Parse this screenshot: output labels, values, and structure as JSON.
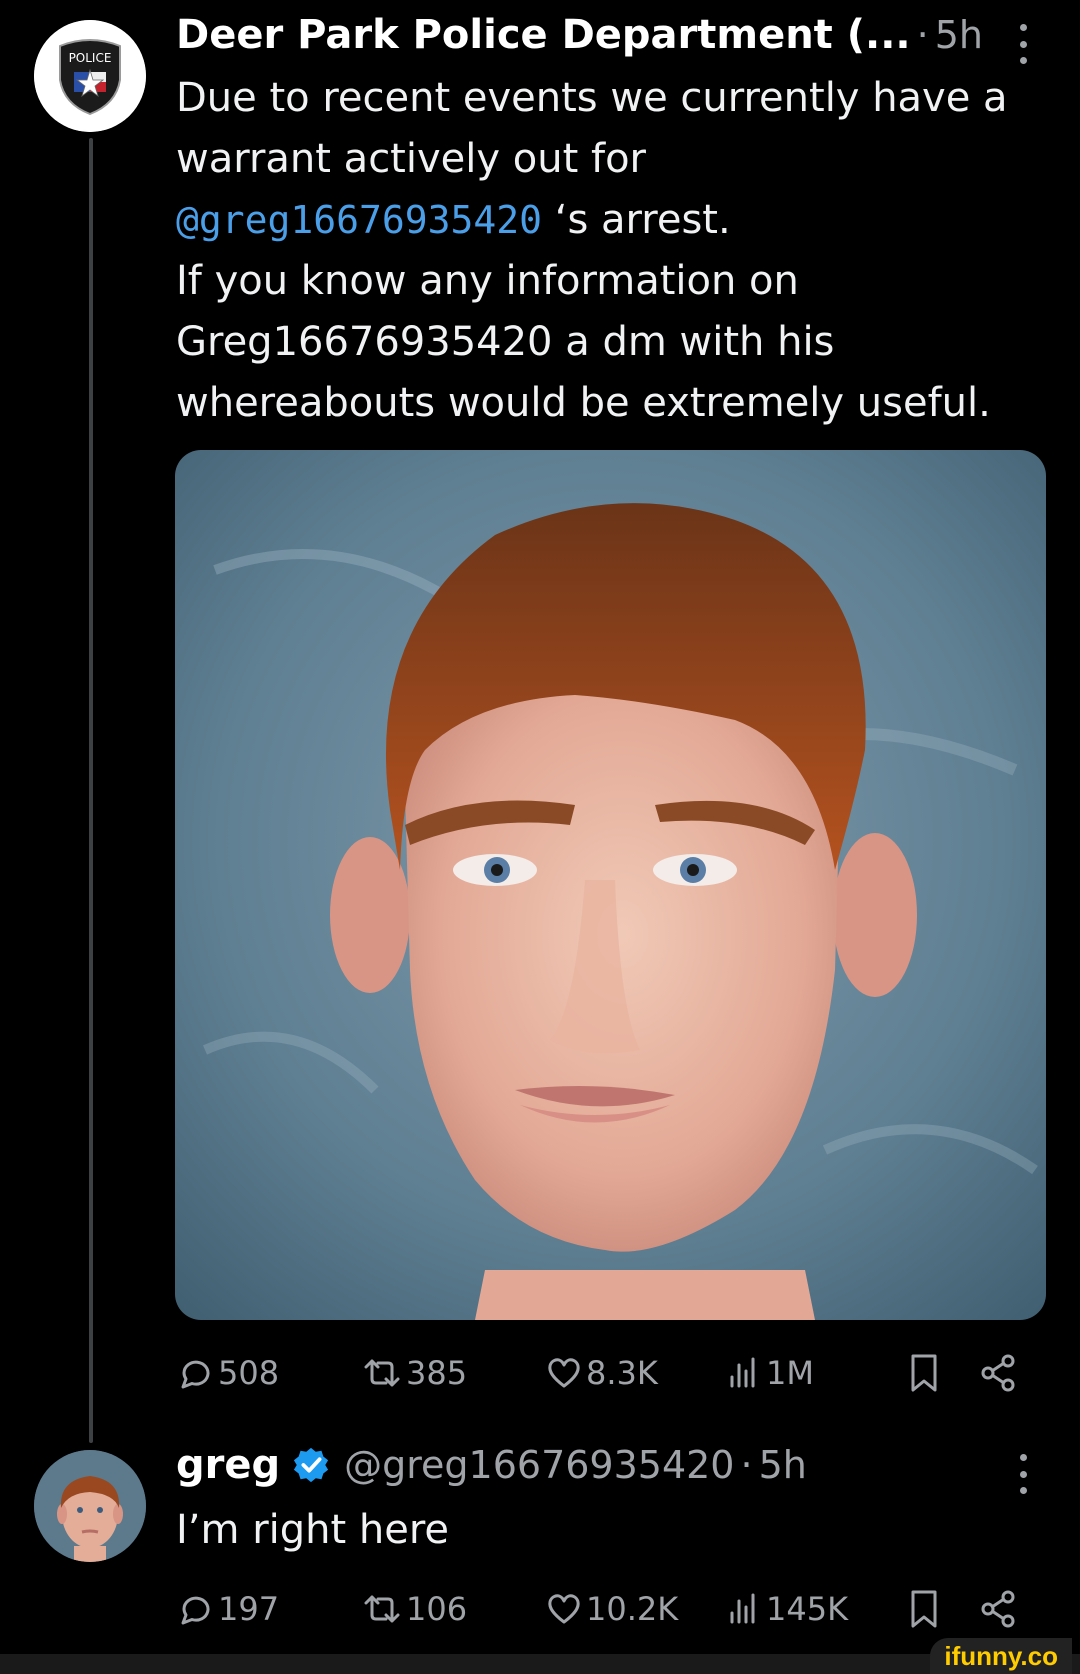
{
  "tweet1": {
    "author": "Deer Park Police Department (...",
    "separator": "·",
    "time": "5h",
    "avatar_badge_text": "POLICE",
    "text_intro": "Due to recent events we currently have a warrant actively out for",
    "mention": "@greg16676935420",
    "text_after_mention": " ‘s arrest.",
    "text_line2": "If you know any information on Greg16676935420 a dm with his whereabouts would be extremely useful.",
    "stats": {
      "replies": "508",
      "reposts": "385",
      "likes": "8.3K",
      "views": "1M"
    }
  },
  "tweet2": {
    "author": "greg",
    "handle": "@greg16676935420",
    "separator": "·",
    "time": "5h",
    "text": "I’m right here",
    "stats": {
      "replies": "197",
      "reposts": "106",
      "likes": "10.2K",
      "views": "145K"
    }
  },
  "watermark": "ifunny.co",
  "colors": {
    "background": "#000000",
    "mention": "#4a9fe8",
    "verified": "#1d9bf0",
    "muted": "#a0a4a8",
    "watermark": "#ffcc00"
  }
}
